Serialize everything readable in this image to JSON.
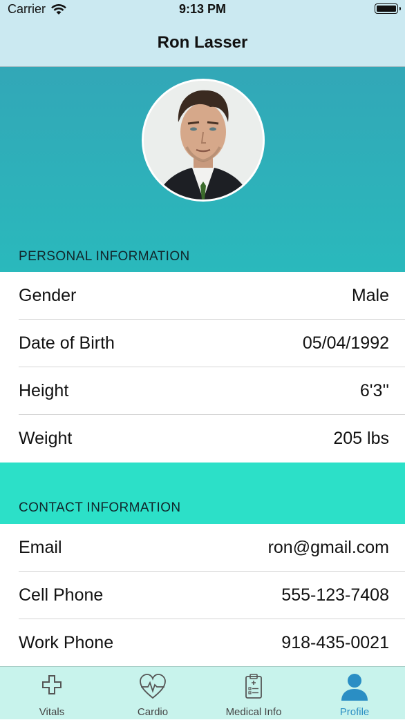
{
  "status_bar": {
    "carrier": "Carrier",
    "time": "9:13 PM"
  },
  "nav": {
    "title": "Ron Lasser"
  },
  "personal": {
    "header": "PERSONAL INFORMATION",
    "rows": [
      {
        "label": "Gender",
        "value": "Male"
      },
      {
        "label": "Date of Birth",
        "value": "05/04/1992"
      },
      {
        "label": "Height",
        "value": "6'3''"
      },
      {
        "label": "Weight",
        "value": "205 lbs"
      }
    ]
  },
  "contact": {
    "header": "CONTACT INFORMATION",
    "rows": [
      {
        "label": "Email",
        "value": "ron@gmail.com"
      },
      {
        "label": "Cell Phone",
        "value": "555-123-7408"
      },
      {
        "label": "Work Phone",
        "value": "918-435-0021"
      }
    ]
  },
  "tabs": [
    {
      "label": "Vitals",
      "icon": "cross-icon"
    },
    {
      "label": "Cardio",
      "icon": "heart-pulse-icon"
    },
    {
      "label": "Medical Info",
      "icon": "clipboard-icon"
    },
    {
      "label": "Profile",
      "icon": "person-icon",
      "active": true
    }
  ],
  "colors": {
    "accent": "#2a8ec4",
    "header_teal": "#2ab9bc",
    "contact_teal": "#2ce0c8",
    "bar_bg": "#cbe9f1"
  }
}
